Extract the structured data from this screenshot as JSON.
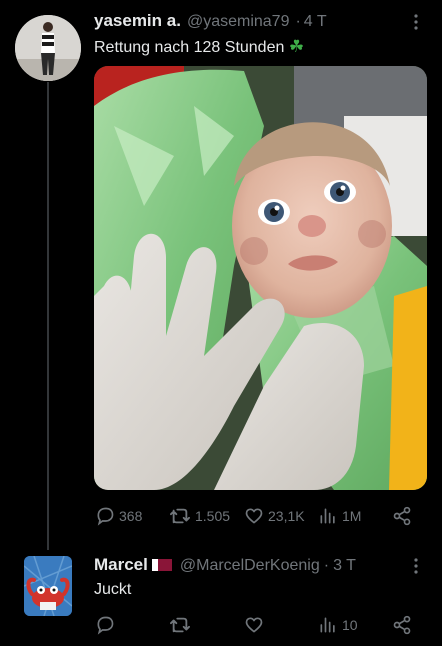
{
  "tweet": {
    "display_name": "yasemin a.",
    "handle": "@yasemina79",
    "separator": "·",
    "time": "4 T",
    "text": "Rettung nach 128 Stunden",
    "emoji": "☘",
    "stats": {
      "replies": "368",
      "retweets": "1.505",
      "likes": "23,1K",
      "views": "1M"
    }
  },
  "reply": {
    "display_name": "Marcel",
    "flag": "🇶🇦",
    "handle": "@MarcelDerKoenig",
    "separator": "·",
    "time": "3 T",
    "text": "Juckt",
    "stats": {
      "views": "10"
    }
  },
  "colors": {
    "background": "#000000",
    "text_primary": "#e7e9ea",
    "text_secondary": "#71767b",
    "thread_line": "#333639"
  },
  "icons": [
    "more-icon",
    "reply-icon",
    "retweet-icon",
    "like-icon",
    "views-icon",
    "share-icon",
    "clover-icon"
  ]
}
